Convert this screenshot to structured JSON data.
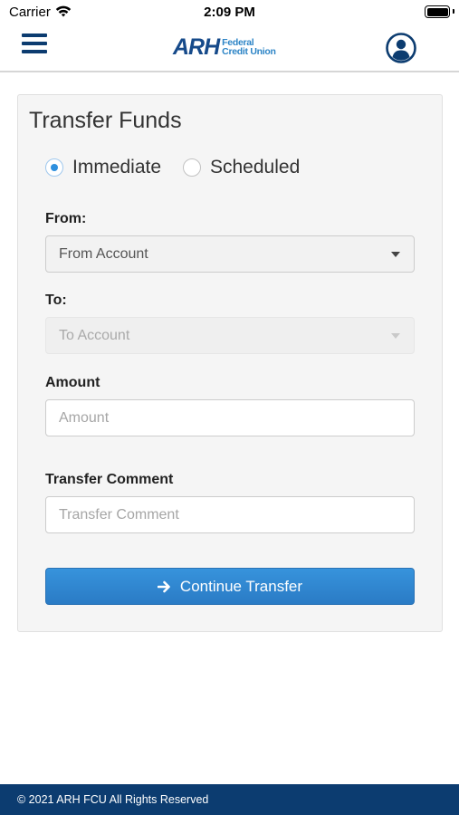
{
  "status_bar": {
    "carrier": "Carrier",
    "time": "2:09 PM"
  },
  "header": {
    "logo_main": "ARH",
    "logo_sub_line1": "Federal",
    "logo_sub_line2": "Credit Union",
    "menu_icon": "hamburger-menu-icon",
    "profile_icon": "user-profile-icon"
  },
  "form": {
    "title": "Transfer Funds",
    "transfer_type": {
      "options": [
        "Immediate",
        "Scheduled"
      ],
      "selected": "Immediate"
    },
    "from": {
      "label": "From:",
      "selected": "From Account"
    },
    "to": {
      "label": "To:",
      "selected": "To Account",
      "disabled": true
    },
    "amount": {
      "label": "Amount",
      "placeholder": "Amount",
      "value": ""
    },
    "comment": {
      "label": "Transfer Comment",
      "placeholder": "Transfer Comment",
      "value": ""
    },
    "submit": {
      "label": "Continue Transfer",
      "icon": "arrow-right-icon"
    }
  },
  "footer": {
    "text": "© 2021 ARH FCU All Rights Reserved"
  },
  "colors": {
    "brand_navy": "#0c3c70",
    "accent_blue": "#2d8fde"
  }
}
